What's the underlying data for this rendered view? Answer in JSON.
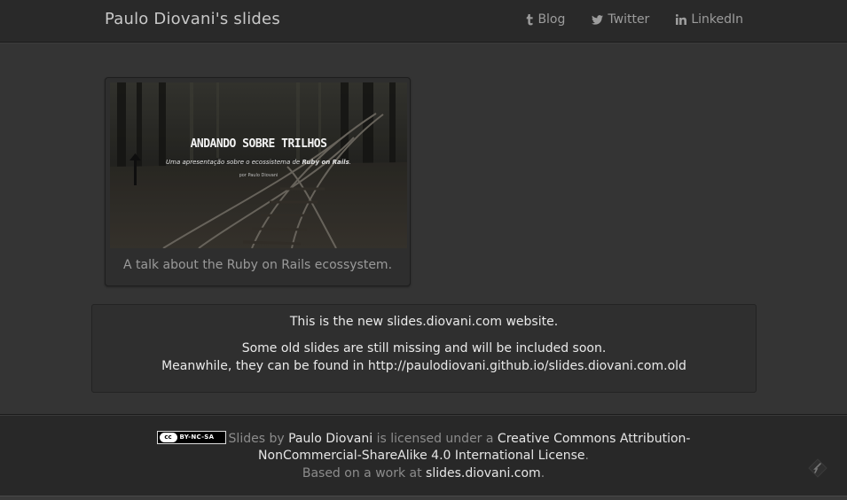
{
  "header": {
    "title": "Paulo Diovani's slides",
    "links": [
      {
        "label": "Blog",
        "icon": "tumblr-icon"
      },
      {
        "label": "Twitter",
        "icon": "twitter-icon"
      },
      {
        "label": "LinkedIn",
        "icon": "linkedin-icon"
      }
    ]
  },
  "slides": [
    {
      "slide_title": "ANDANDO SOBRE TRILHOS",
      "slide_subtitle_prefix": "Uma apresentação sobre o ecossistema de ",
      "slide_subtitle_emph": "Ruby on Rails",
      "slide_subtitle_suffix": ".",
      "slide_author": "por Paulo Diovani",
      "caption": "A talk about the Ruby on Rails ecossystem."
    }
  ],
  "notice": {
    "line1": "This is the new slides.diovani.com website.",
    "line2": "Some old slides are still missing and will be included soon.",
    "line3": "Meanwhile, they can be found in http://paulodiovani.github.io/slides.diovani.com.old"
  },
  "footer": {
    "cc_symbol": "cc",
    "cc_badge": "BY-NC-SA",
    "text1": "Slides by ",
    "author": "Paulo Diovani",
    "text2": " is licensed under a ",
    "license_part1": "Creative Commons Attribution-",
    "license_part2": "NonCommercial-ShareAlike 4.0 International License",
    "text3": ".",
    "text4": "Based on a work at ",
    "site": "slides.diovani.com",
    "text5": "."
  },
  "colors": {
    "background": "#343434",
    "navbar": "#292929",
    "footer": "#282828",
    "text_light": "#e6e6e6",
    "text_muted": "#8c8c8c"
  }
}
